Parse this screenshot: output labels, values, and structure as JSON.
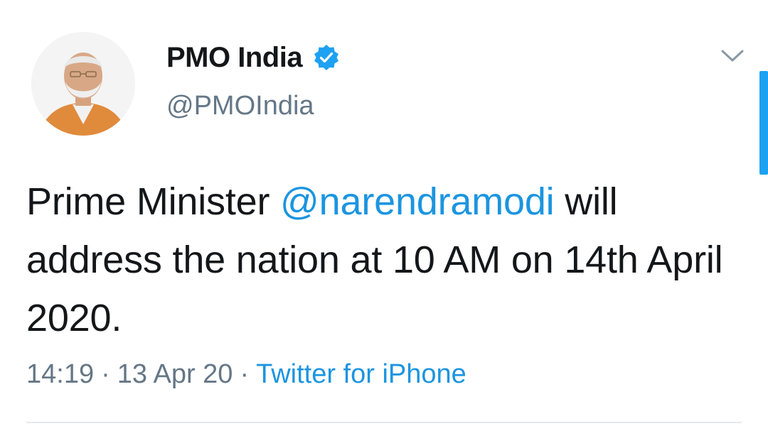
{
  "author": {
    "display_name": "PMO India",
    "handle": "@PMOIndia",
    "verified": true,
    "avatar_icon": "avatar-photo-icon",
    "verified_icon": "verified-badge-icon"
  },
  "tweet": {
    "text_before_mention": "Prime Minister ",
    "mention": "@narendramodi",
    "text_after_mention": " will address the nation at 10 AM on 14th April 2020."
  },
  "meta": {
    "time": "14:19",
    "date": "13 Apr 20",
    "source": "Twitter for iPhone",
    "separator": "·"
  },
  "controls": {
    "more_icon": "chevron-down-icon"
  },
  "colors": {
    "text": "#14171a",
    "secondary": "#657786",
    "link": "#1b95e0",
    "verified": "#1da1f2",
    "divider": "#e1e8ed"
  }
}
